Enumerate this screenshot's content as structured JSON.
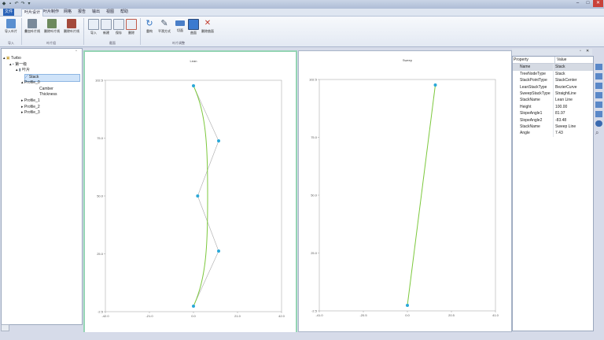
{
  "menu": {
    "file_tab": "文件",
    "tabs": [
      "叶片设计",
      "叶片制作",
      "网格",
      "报告",
      "输出",
      "视图",
      "帮助"
    ]
  },
  "ribbon": {
    "buttons": [
      "导入叶片",
      "叠加叶片线",
      "删除叶片线",
      "删除叶片线",
      "导入",
      "新建",
      "保存",
      "删除",
      "重构",
      "平滑方式",
      "切面",
      "曲面",
      "删除曲面"
    ],
    "groups": [
      "导入",
      "叶片组",
      "截面",
      "叶片调整"
    ]
  },
  "tree": {
    "root": "Turbo",
    "stage": "第一级",
    "blade": "叶片",
    "stack": "Stack",
    "profile0": "Profile_0",
    "camber": "Camber",
    "thickness": "Thickness",
    "profile1": "Profile_1",
    "profile2": "Profile_2",
    "profile3": "Profile_3"
  },
  "chart_data": [
    {
      "type": "scatter",
      "title": "Lean",
      "xlim": [
        -42.0,
        42.0
      ],
      "ylim": [
        -2.5,
        102.5
      ],
      "x_ticks": [
        "-42.0",
        "-21.0",
        "0.0",
        "21.0",
        "42.0"
      ],
      "y_ticks": [
        "-2.5",
        "25.0",
        "50.0",
        "75.0",
        "102.5"
      ],
      "control_points": [
        [
          0.0,
          0.0
        ],
        [
          12.0,
          25.0
        ],
        [
          2.0,
          50.0
        ],
        [
          12.0,
          75.0
        ],
        [
          0.0,
          100.0
        ]
      ],
      "curve_color": "#7cc83c",
      "polyline_color": "#aaaaaa",
      "point_color": "#2aa8d8"
    },
    {
      "type": "scatter",
      "title": "Sweep",
      "xlim": [
        -41.0,
        41.0
      ],
      "ylim": [
        -2.5,
        102.5
      ],
      "x_ticks": [
        "-41.0",
        "-20.5",
        "0.0",
        "20.5",
        "41.0"
      ],
      "y_ticks": [
        "-2.5",
        "25.0",
        "50.0",
        "75.0",
        "102.5"
      ],
      "control_points": [
        [
          0.0,
          0.0
        ],
        [
          13.0,
          100.0
        ]
      ],
      "curve_color": "#7cc83c",
      "point_color": "#2aa8d8"
    }
  ],
  "properties": {
    "header": [
      "Property",
      "Value"
    ],
    "rows": [
      [
        "Name",
        "Stack"
      ],
      [
        "TreeNodeType",
        "Stack"
      ],
      [
        "StackPointType",
        "StackCenter"
      ],
      [
        "LeanStackType",
        "BezierCurve"
      ],
      [
        "SweepStackType",
        "StraightLine"
      ],
      [
        "StackName",
        "Lean Line"
      ],
      [
        "Height",
        "100.00"
      ],
      [
        "SlopeAngle1",
        "81.97"
      ],
      [
        "SlopeAngle2",
        "-83.48"
      ],
      [
        "StackName",
        "Sweep Line"
      ],
      [
        "Angle",
        "7.43"
      ]
    ]
  }
}
